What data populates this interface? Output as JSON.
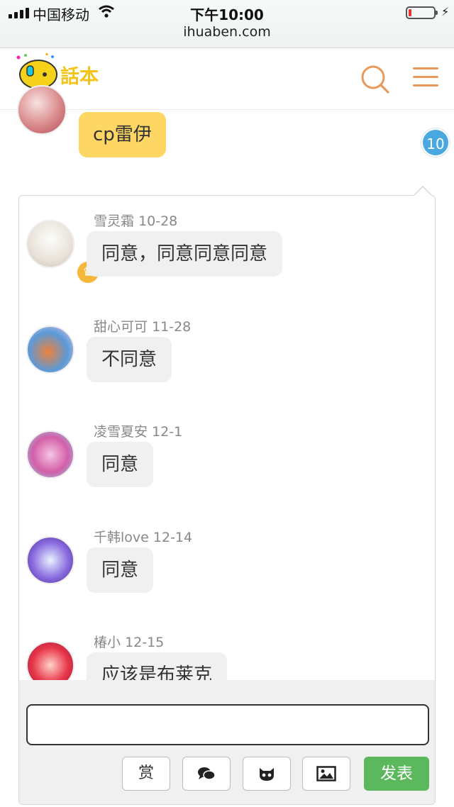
{
  "status_bar": {
    "carrier": "中国移动",
    "time": "下午10:00",
    "url": "ihuaben.com"
  },
  "header": {
    "logo_text": "話本",
    "icons": [
      "search-icon",
      "menu-icon"
    ],
    "accent_color": "#e99a5b"
  },
  "parent_comment": {
    "text": "cp雷伊",
    "reply_count": "10",
    "bubble_color": "#fdd664",
    "badge_color": "#4aa8e0"
  },
  "replies": [
    {
      "user": "雪灵霜",
      "date": "10-28",
      "text": "同意，同意同意同意",
      "vip": true
    },
    {
      "user": "甜心可可",
      "date": "11-28",
      "text": "不同意",
      "vip": false
    },
    {
      "user": "凌雪夏安",
      "date": "12-1",
      "text": "同意",
      "vip": false
    },
    {
      "user": "千韩love",
      "date": "12-14",
      "text": "同意",
      "vip": false
    },
    {
      "user": "椿小",
      "date": "12-15",
      "text": "应该是布莱克",
      "vip": false
    }
  ],
  "composer": {
    "input_value": "",
    "reward_label": "赏",
    "tool_icons": [
      "chat-bubbles-icon",
      "github-cat-icon",
      "image-icon"
    ],
    "send_label": "发表",
    "send_color": "#5cb85c"
  }
}
